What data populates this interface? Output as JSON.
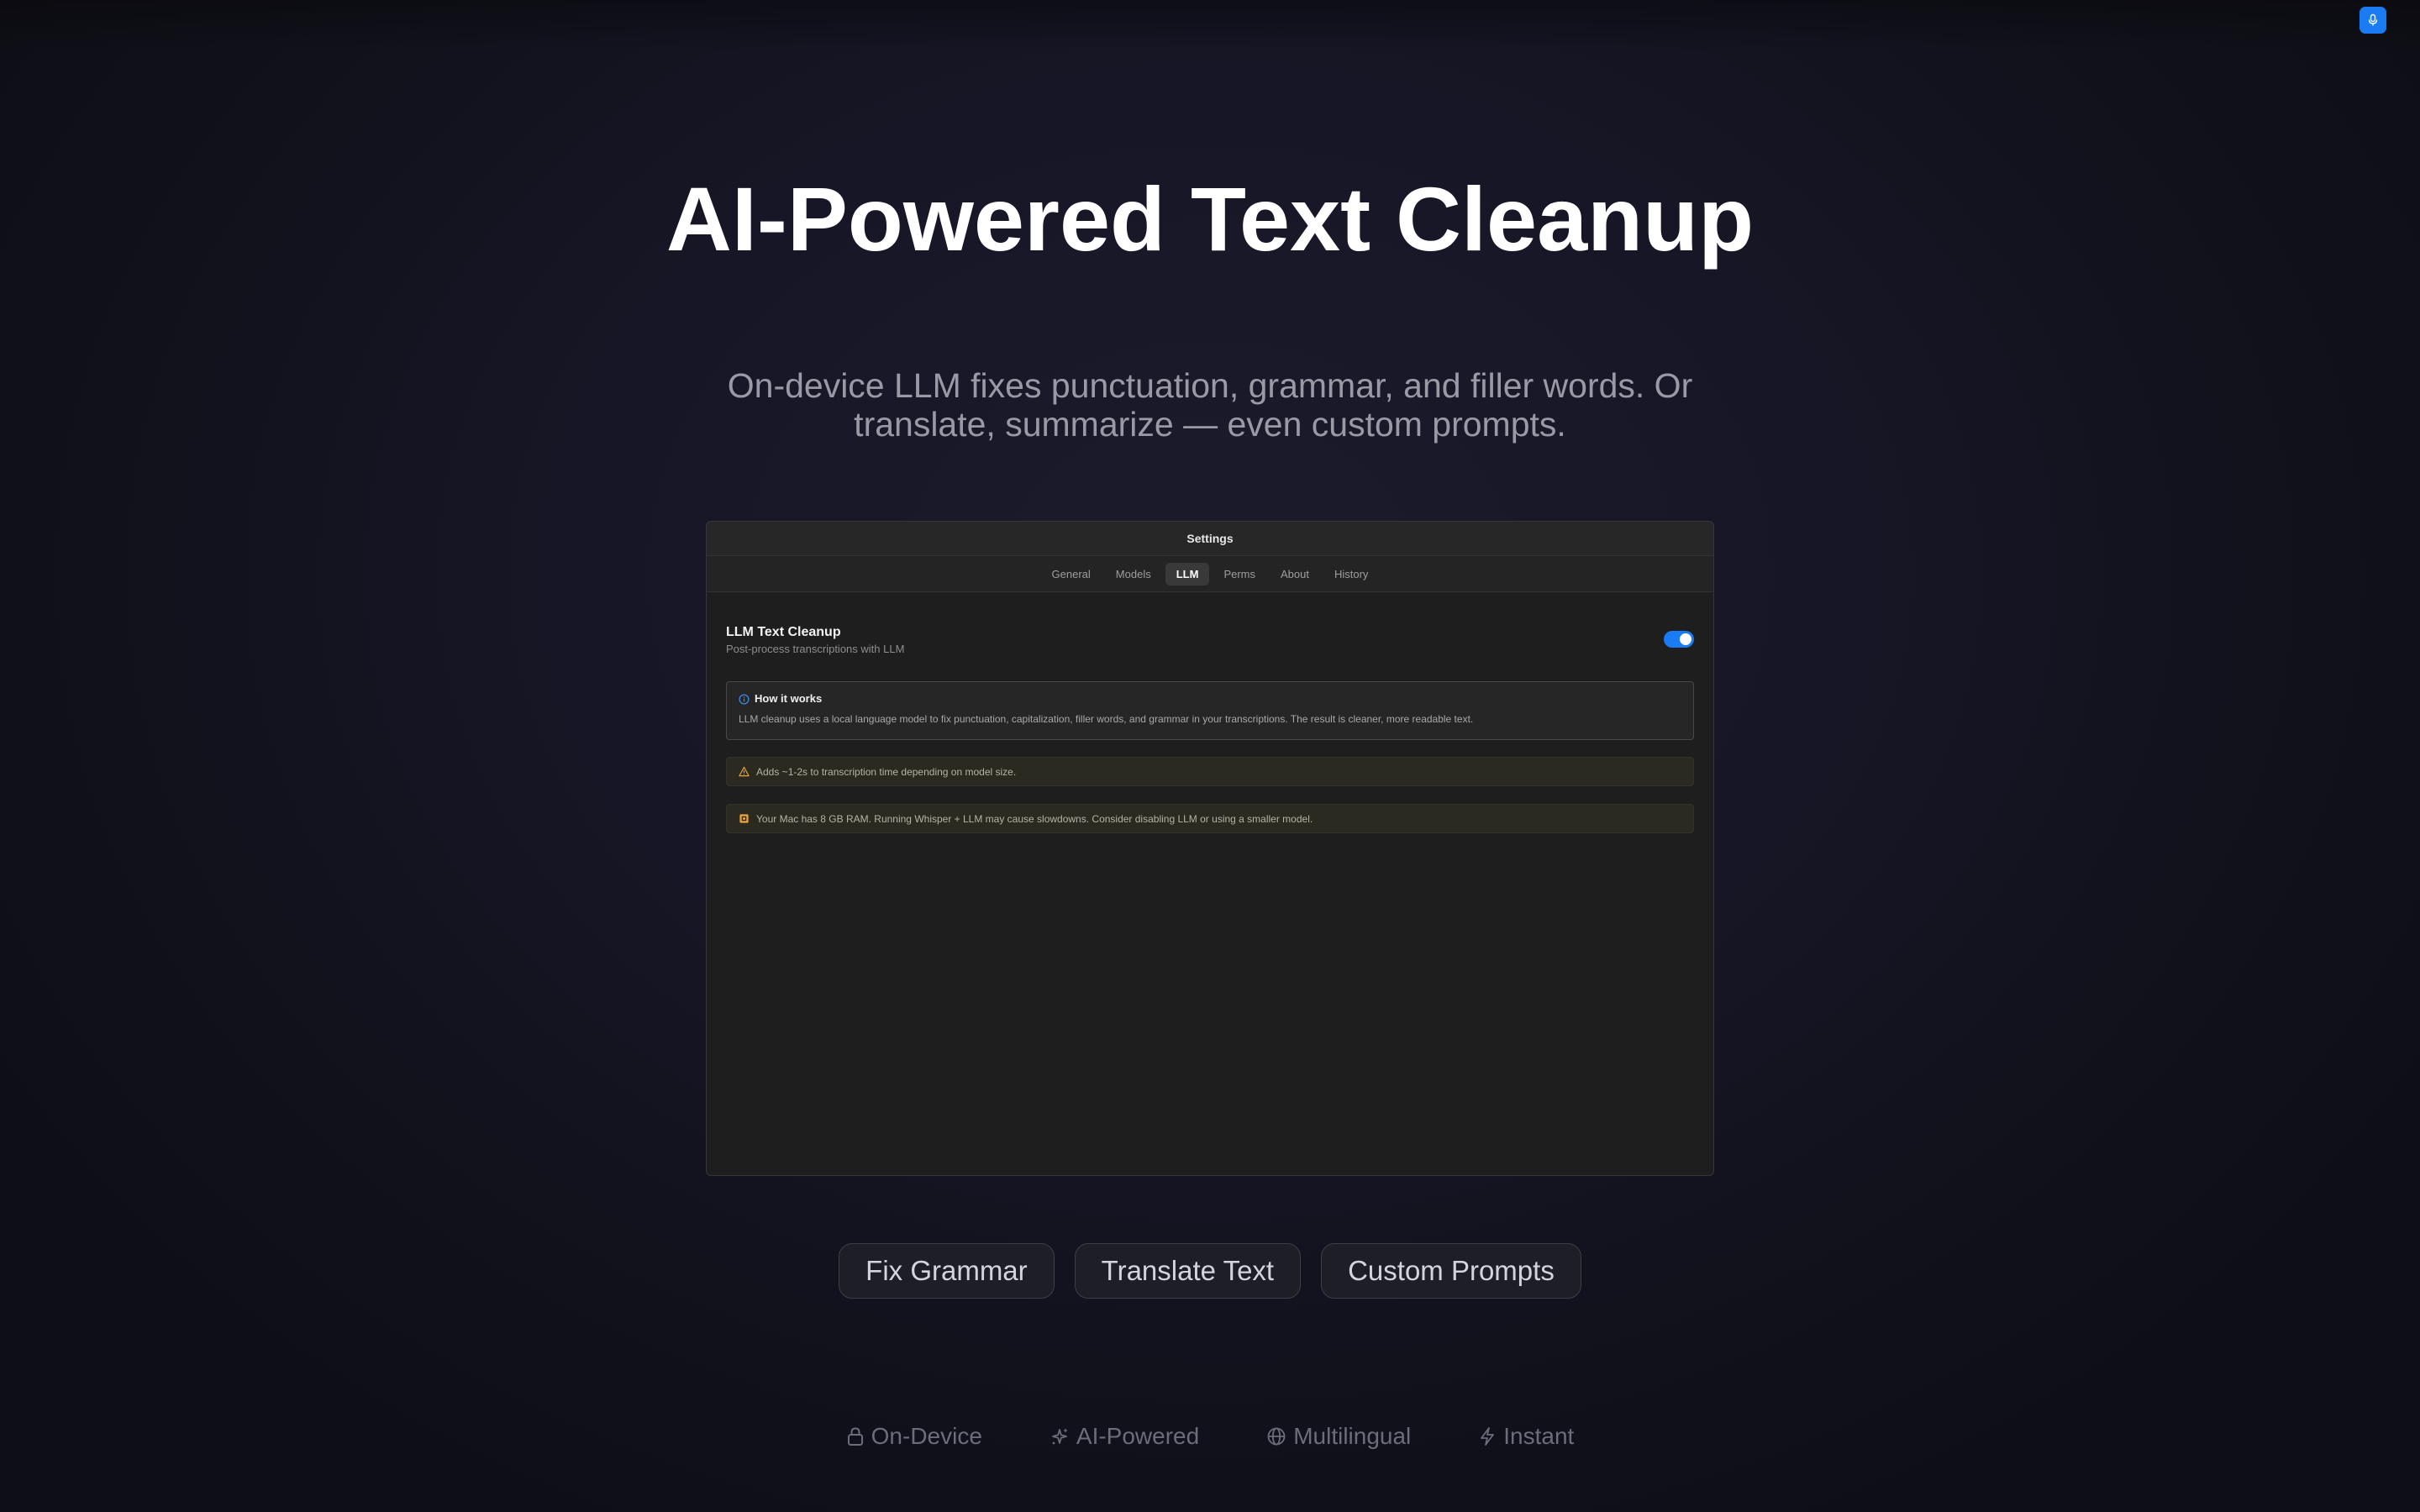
{
  "hero": {
    "title": "AI-Powered Text Cleanup",
    "subtitle": "On-device LLM fixes punctuation, grammar, and filler words. Or translate, summarize — even custom prompts."
  },
  "window": {
    "title": "Settings",
    "tabs": [
      {
        "label": "General",
        "active": false
      },
      {
        "label": "Models",
        "active": false
      },
      {
        "label": "LLM",
        "active": true
      },
      {
        "label": "Perms",
        "active": false
      },
      {
        "label": "About",
        "active": false
      },
      {
        "label": "History",
        "active": false
      }
    ],
    "llm_toggle": {
      "title": "LLM Text Cleanup",
      "description": "Post-process transcriptions with LLM",
      "enabled": true
    },
    "info": {
      "icon": "info-icon",
      "heading": "How it works",
      "body": "LLM cleanup uses a local language model to fix punctuation, capitalization, filler words, and grammar in your transcriptions. The result is cleaner, more readable text."
    },
    "warnings": [
      {
        "icon": "warning-triangle-icon",
        "text": "Adds ~1-2s to transcription time depending on model size."
      },
      {
        "icon": "memory-chip-icon",
        "text": "Your Mac has 8 GB RAM. Running Whisper + LLM may cause slowdowns. Consider disabling LLM or using a smaller model."
      }
    ]
  },
  "pills": [
    "Fix Grammar",
    "Translate Text",
    "Custom Prompts"
  ],
  "features": [
    {
      "icon": "lock-icon",
      "label": "On-Device"
    },
    {
      "icon": "sparkles-icon",
      "label": "AI-Powered"
    },
    {
      "icon": "globe-icon",
      "label": "Multilingual"
    },
    {
      "icon": "lightning-icon",
      "label": "Instant"
    }
  ],
  "colors": {
    "accent": "#1a7cf2",
    "warning": "#e8a33a",
    "info": "#3c8ee8"
  }
}
